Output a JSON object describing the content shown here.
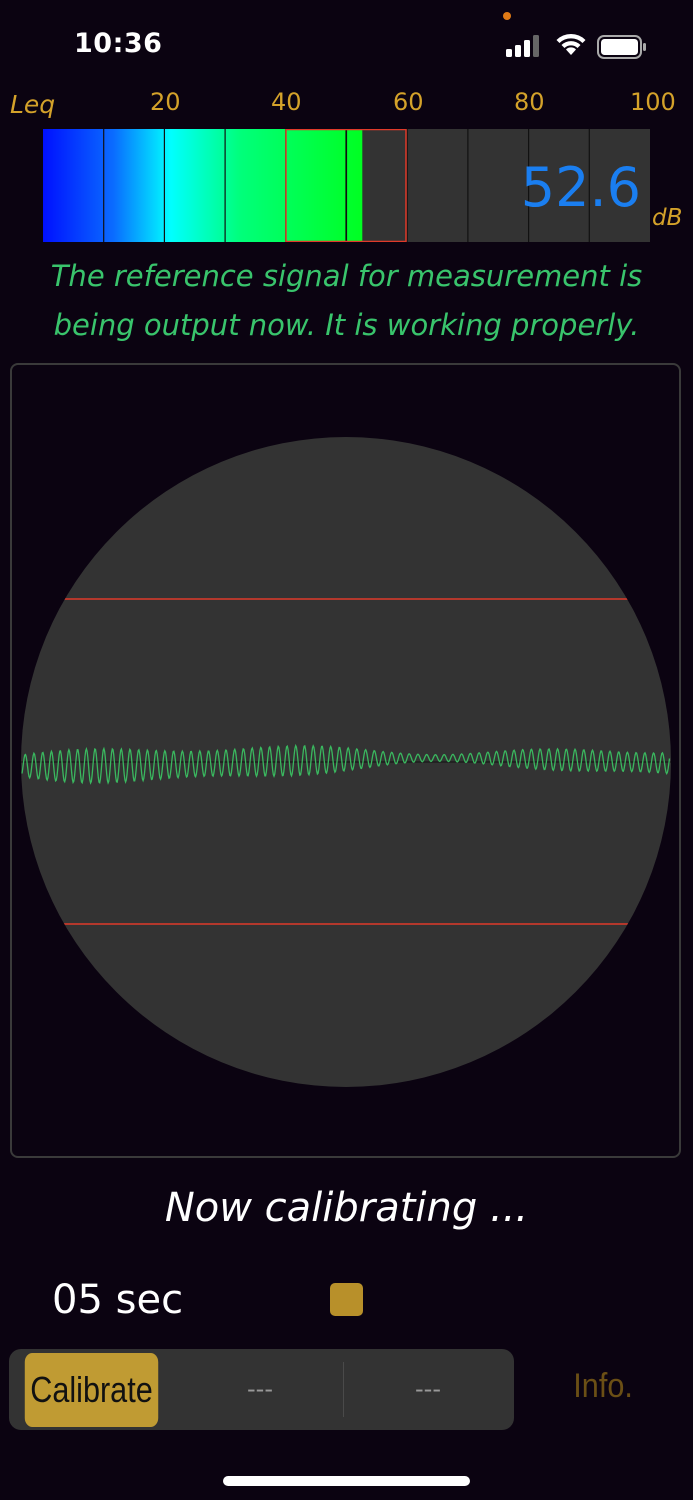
{
  "status_bar": {
    "time": "10:36"
  },
  "meter": {
    "label": "Leq",
    "scale": [
      "20",
      "40",
      "60",
      "80",
      "100"
    ],
    "value": "52.6",
    "unit": "dB",
    "level_fraction": 0.526,
    "colors": {
      "value": "#1a7ef0",
      "label": "#d4a22a",
      "marker": "#e03a2a"
    }
  },
  "message": {
    "line1": "The reference signal for measurement is",
    "line2": "being output now.  It is working properly."
  },
  "calibration": {
    "status": "Now calibrating ...",
    "timer": "05 sec"
  },
  "segmented_control": {
    "calibrate_label": "Calibrate",
    "option2_label": "---",
    "option3_label": "---"
  },
  "info_label": "Info."
}
